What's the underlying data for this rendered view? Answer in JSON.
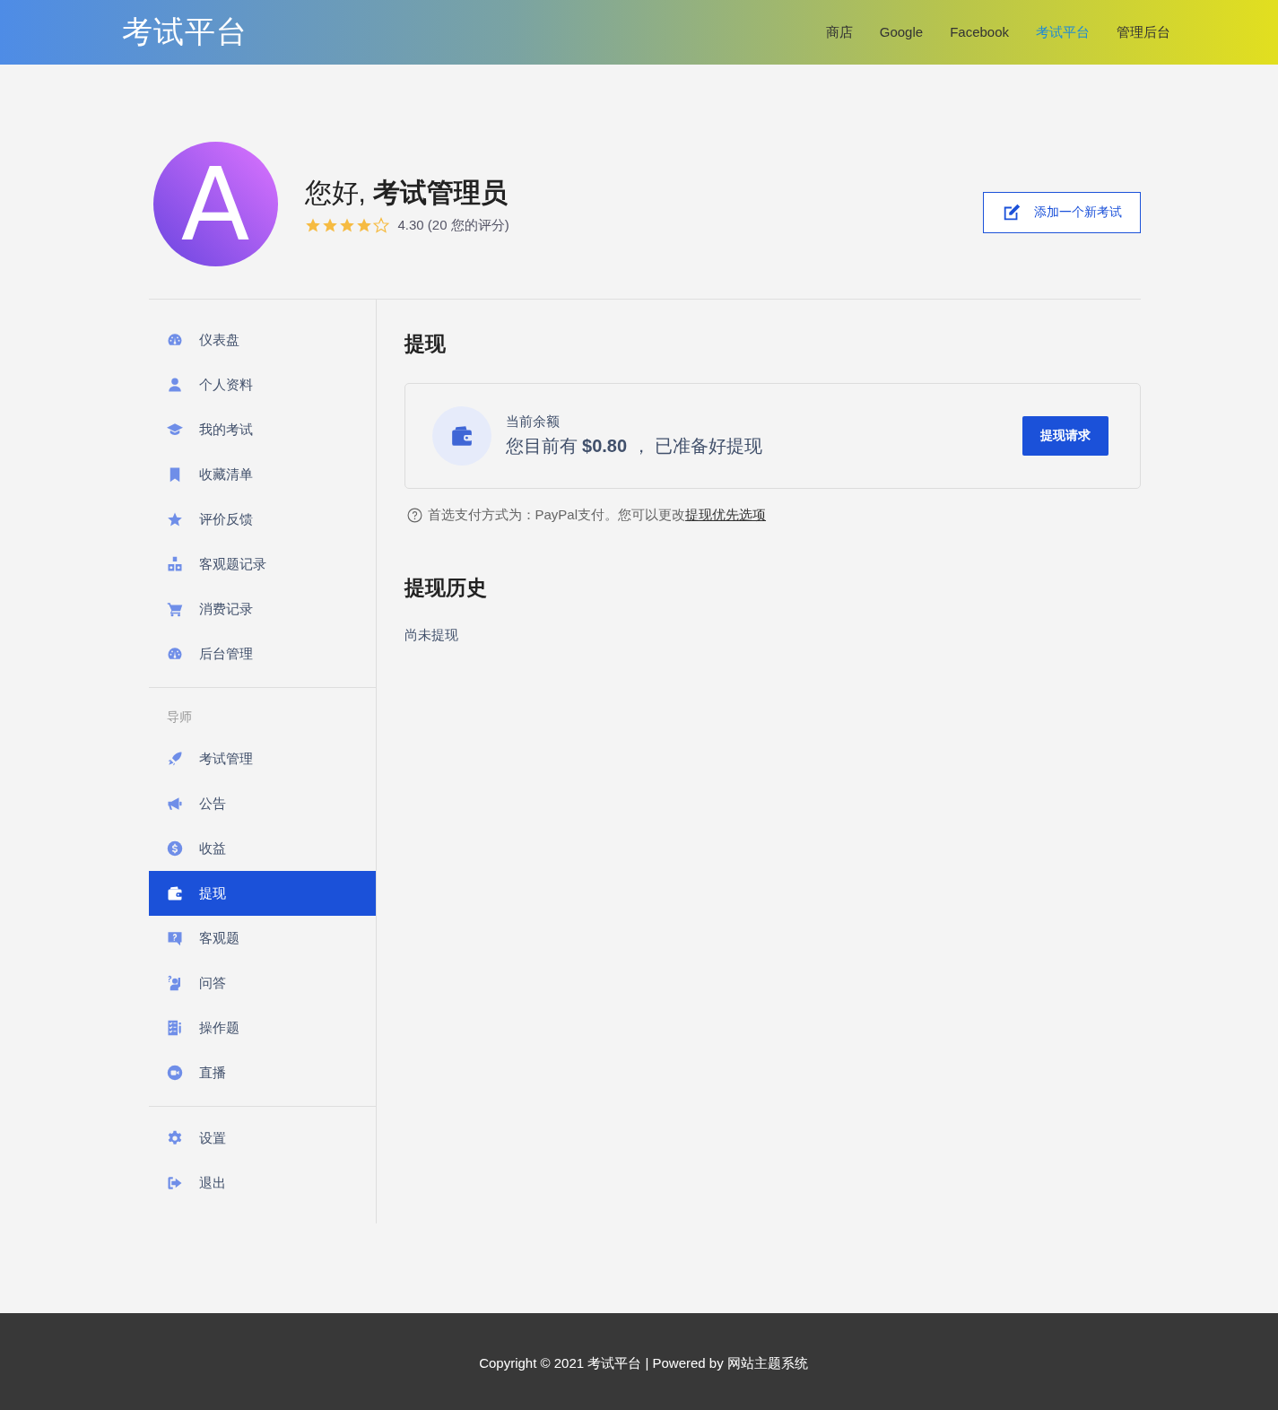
{
  "header": {
    "logo": "考试平台",
    "nav": [
      {
        "label": "商店",
        "selected": false
      },
      {
        "label": "Google",
        "selected": false
      },
      {
        "label": "Facebook",
        "selected": false
      },
      {
        "label": "考试平台",
        "selected": true
      },
      {
        "label": "管理后台",
        "selected": false
      }
    ]
  },
  "profile": {
    "avatar_letter": "A",
    "greeting": "您好, **考试管理员**",
    "stars": 4,
    "rating": "4.30 (20 您的评分)",
    "add_button": "添加一个新考试"
  },
  "sidebar": {
    "sections": [
      {
        "items": [
          {
            "kind": "gauge",
            "label": "仪表盘",
            "selected": false
          },
          {
            "kind": "user",
            "label": "个人资料",
            "selected": false
          },
          {
            "kind": "cap",
            "label": "我的考试",
            "selected": false
          },
          {
            "kind": "bookmark",
            "label": "收藏清单",
            "selected": false
          },
          {
            "kind": "star",
            "label": "评价反馈",
            "selected": false
          },
          {
            "kind": "shapes",
            "label": "客观题记录",
            "selected": false
          },
          {
            "kind": "cart",
            "label": "消费记录",
            "selected": false
          },
          {
            "kind": "gauge",
            "label": "后台管理",
            "selected": false
          }
        ]
      },
      {
        "heading": "导师",
        "items": [
          {
            "kind": "rocket",
            "label": "考试管理",
            "selected": false
          },
          {
            "kind": "megaphone",
            "label": "公告",
            "selected": false
          },
          {
            "kind": "dollar",
            "label": "收益",
            "selected": false
          },
          {
            "kind": "wallet",
            "label": "提现",
            "selected": true
          },
          {
            "kind": "question",
            "label": "客观题",
            "selected": false
          },
          {
            "kind": "person",
            "label": "问答",
            "selected": false
          },
          {
            "kind": "checklist",
            "label": "操作题",
            "selected": false
          },
          {
            "kind": "video",
            "label": "直播",
            "selected": false
          }
        ]
      },
      {
        "items": [
          {
            "kind": "gear",
            "label": "设置",
            "selected": false
          },
          {
            "kind": "logout",
            "label": "退出",
            "selected": false
          }
        ]
      }
    ]
  },
  "main": {
    "title": "提现",
    "balance": {
      "label": "当前余额",
      "text": "您目前有 **$0.80** ， 已准备好提现",
      "button": "提现请求"
    },
    "note": "首选支付方式为：PayPal支付。您可以更改",
    "note_link": "提现优先选项",
    "history_title": "提现历史",
    "history_empty": "尚未提现"
  },
  "footer": "Copyright © 2021 考试平台 | Powered by 网站主题系统"
}
